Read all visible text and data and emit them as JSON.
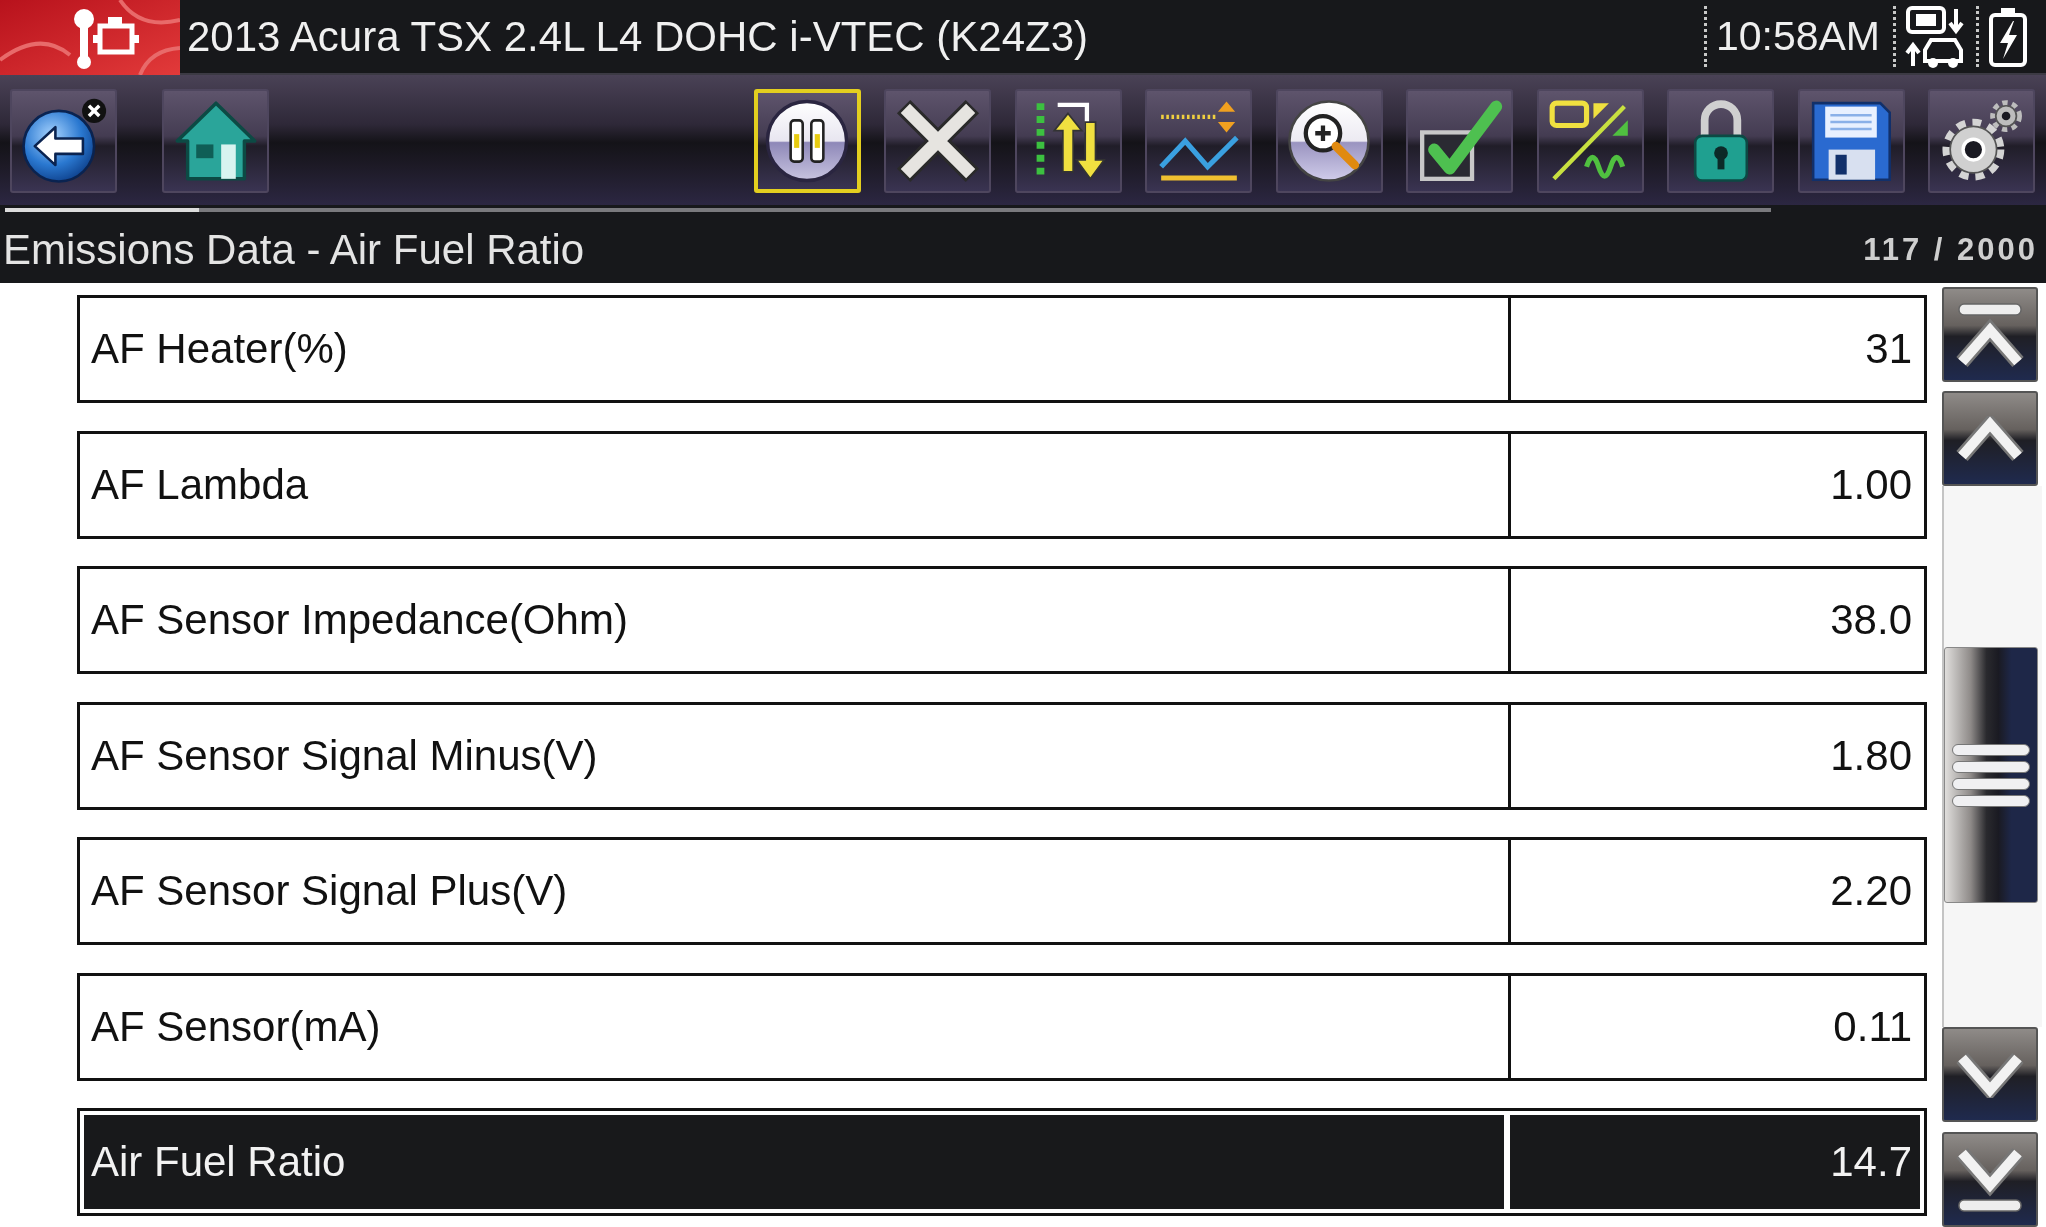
{
  "status_bar": {
    "vehicle": "2013 Acura TSX 2.4L L4 DOHC i-VTEC (K24Z3)",
    "time": "10:58AM"
  },
  "toolbar": {
    "left_buttons": [
      {
        "kind": "back",
        "selected": false
      },
      {
        "kind": "home",
        "selected": false
      }
    ],
    "right_buttons": [
      {
        "kind": "pause",
        "selected": true
      },
      {
        "kind": "clear",
        "selected": false
      },
      {
        "kind": "sort",
        "selected": false
      },
      {
        "kind": "graph",
        "selected": false
      },
      {
        "kind": "zoom",
        "selected": false
      },
      {
        "kind": "select",
        "selected": false
      },
      {
        "kind": "units",
        "selected": false
      },
      {
        "kind": "lock",
        "selected": false
      },
      {
        "kind": "save",
        "selected": false
      },
      {
        "kind": "tools",
        "selected": false
      }
    ]
  },
  "buffer": {
    "level": 0.11
  },
  "data_view": {
    "title": "Emissions Data - Air Fuel Ratio",
    "counter": "117 / 2000",
    "rows": [
      {
        "name": "AF Heater(%)",
        "value": "31",
        "selected": false
      },
      {
        "name": "AF Lambda",
        "value": "1.00",
        "selected": false
      },
      {
        "name": "AF Sensor Impedance(Ohm)",
        "value": "38.0",
        "selected": false
      },
      {
        "name": "AF Sensor Signal Minus(V)",
        "value": "1.80",
        "selected": false
      },
      {
        "name": "AF Sensor Signal Plus(V)",
        "value": "2.20",
        "selected": false
      },
      {
        "name": "AF Sensor(mA)",
        "value": "0.11",
        "selected": false
      },
      {
        "name": "Air Fuel Ratio",
        "value": "14.7",
        "selected": true
      }
    ]
  }
}
